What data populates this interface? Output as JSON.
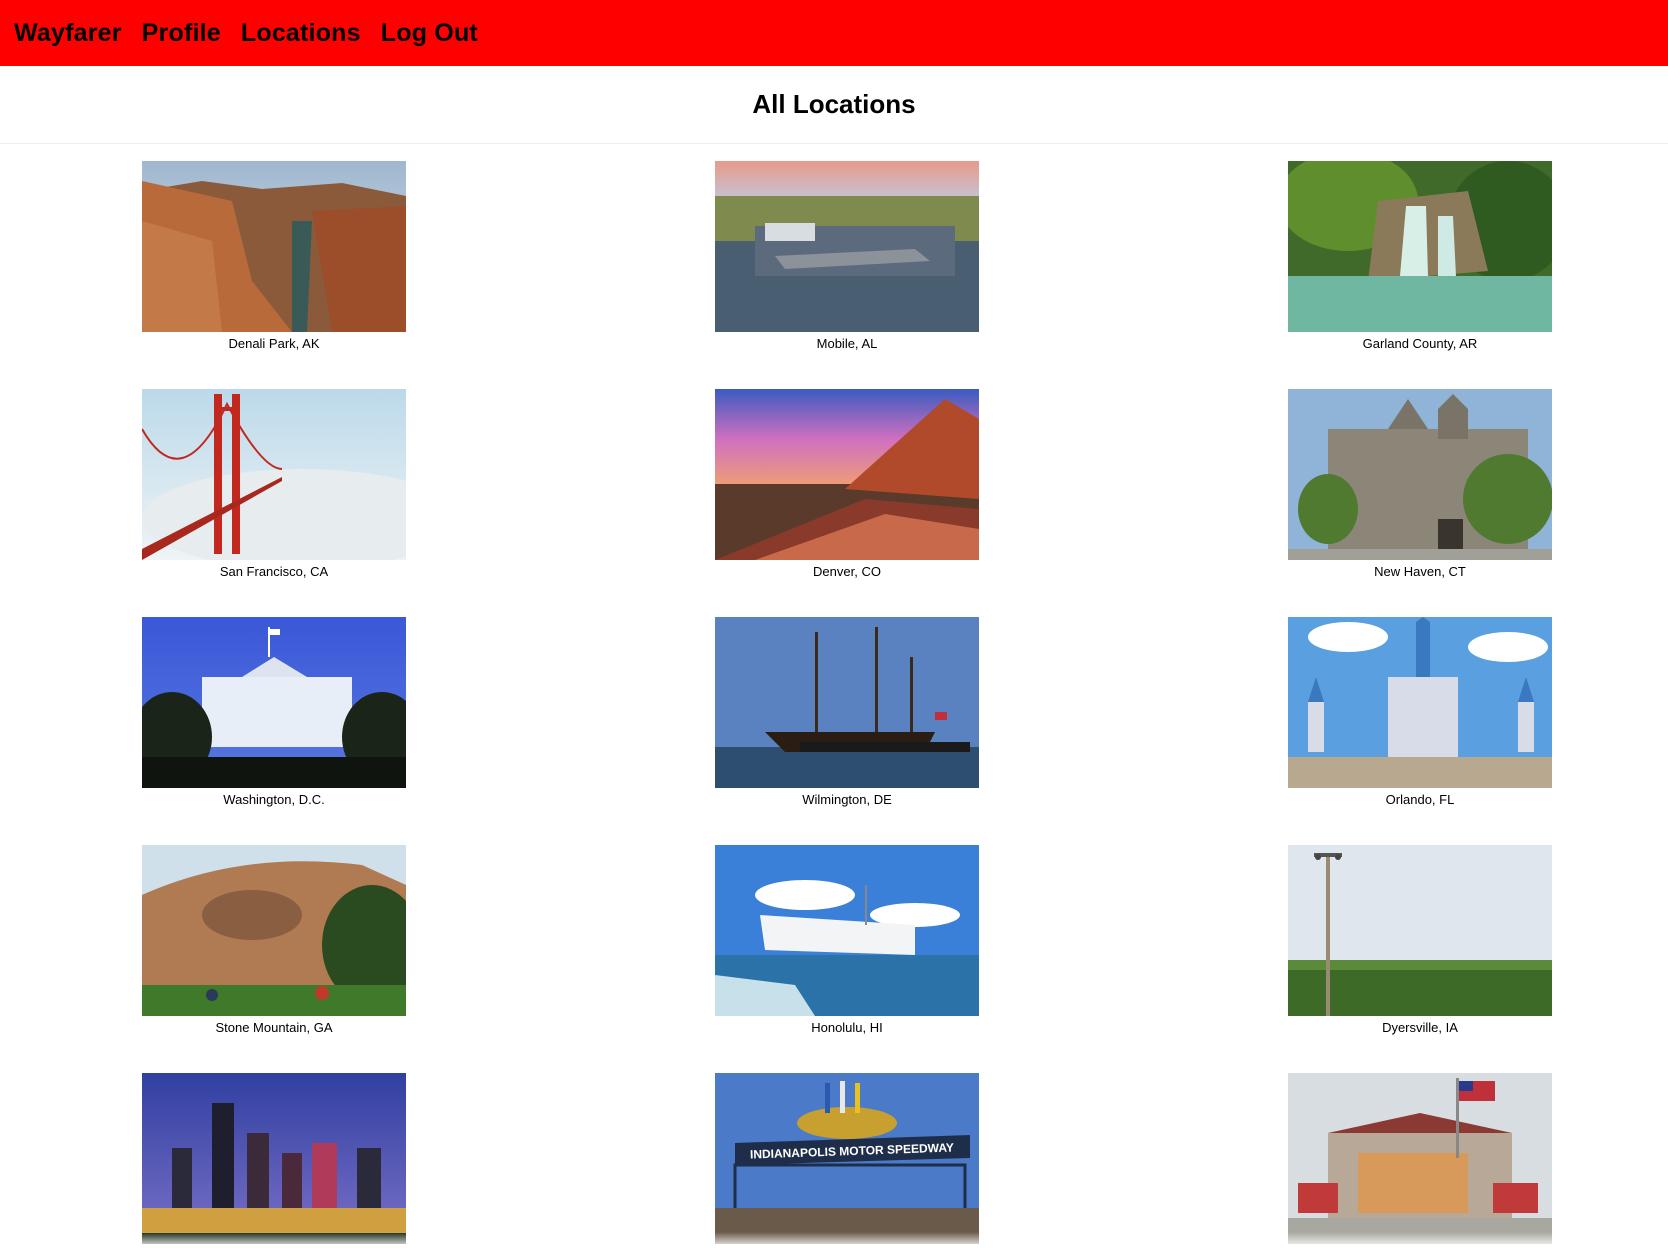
{
  "nav": {
    "brand": "Wayfarer",
    "links": [
      "Profile",
      "Locations",
      "Log Out"
    ]
  },
  "page_title": "All Locations",
  "locations": [
    {
      "caption": "Denali Park, AK",
      "image": "canyon-photo"
    },
    {
      "caption": "Mobile, AL",
      "image": "battleship-harbor-photo"
    },
    {
      "caption": "Garland County, AR",
      "image": "waterfall-photo"
    },
    {
      "caption": "San Francisco, CA",
      "image": "golden-gate-bridge-photo"
    },
    {
      "caption": "Denver, CO",
      "image": "red-rocks-amphitheatre-photo"
    },
    {
      "caption": "New Haven, CT",
      "image": "gothic-university-building-photo"
    },
    {
      "caption": "Washington, D.C.",
      "image": "white-house-photo"
    },
    {
      "caption": "Wilmington, DE",
      "image": "tall-ship-photo"
    },
    {
      "caption": "Orlando, FL",
      "image": "castle-photo"
    },
    {
      "caption": "Stone Mountain, GA",
      "image": "granite-mountain-photo"
    },
    {
      "caption": "Honolulu, HI",
      "image": "memorial-photo"
    },
    {
      "caption": "Dyersville, IA",
      "image": "cornfield-photo"
    },
    {
      "caption": "",
      "image": "city-skyline-photo"
    },
    {
      "caption": "",
      "image": "motor-speedway-photo",
      "sign_text": "INDIANAPOLIS MOTOR SPEEDWAY"
    },
    {
      "caption": "",
      "image": "hall-of-fame-building-photo"
    }
  ],
  "colors": {
    "navbar": "#ff0000",
    "text": "#000000",
    "background": "#ffffff"
  }
}
